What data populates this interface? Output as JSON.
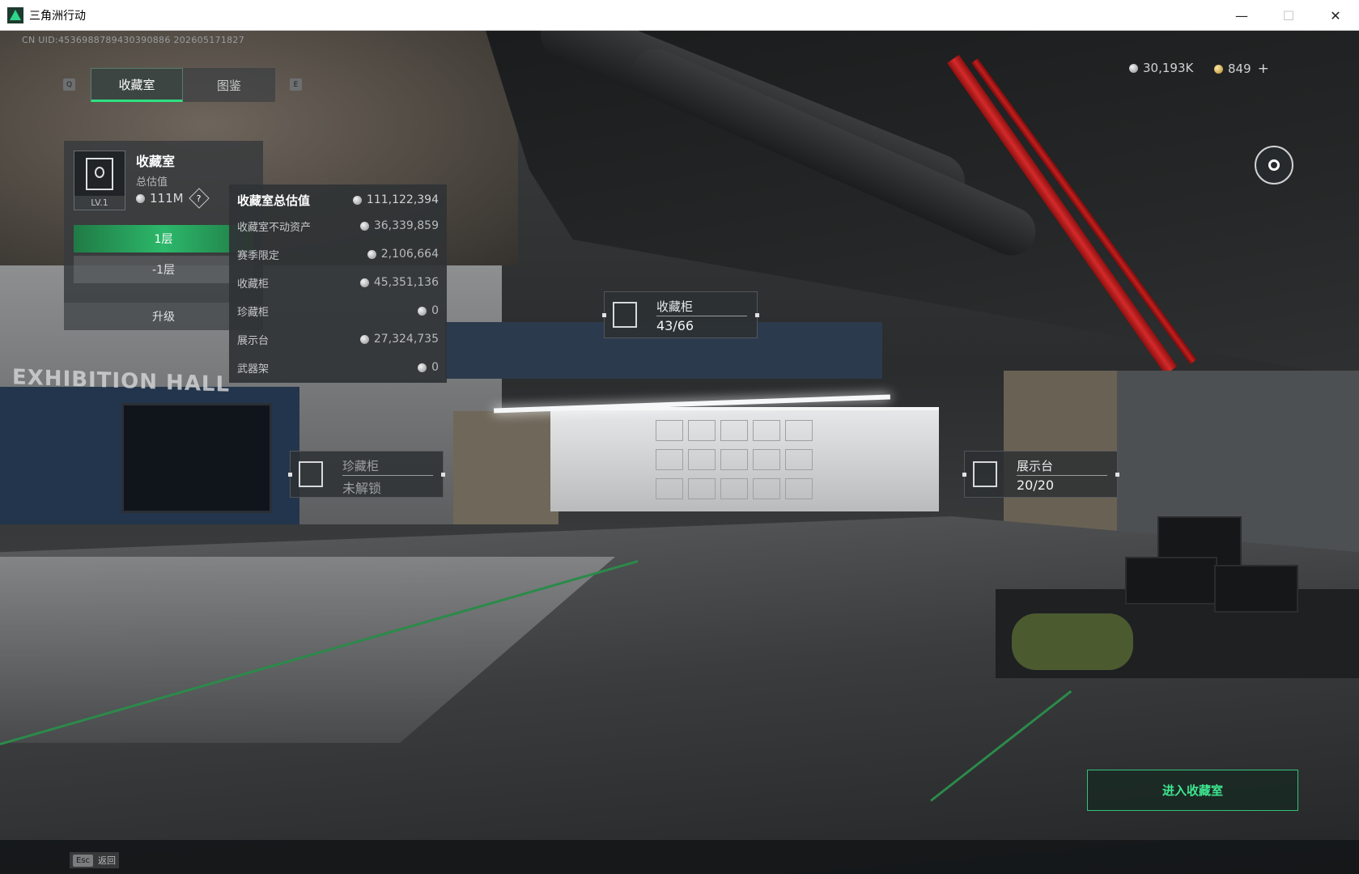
{
  "window": {
    "title": "三角洲行动",
    "minimize": "—",
    "maximize": "☐",
    "close": "✕"
  },
  "uid": "CN UID:4536988789430390886 202605171827",
  "currency": {
    "silver": "30,193K",
    "gold": "849",
    "plus": "+"
  },
  "tabs": {
    "key_left": "Q",
    "key_right": "E",
    "items": [
      {
        "label": "收藏室",
        "active": true
      },
      {
        "label": "图鉴",
        "active": false
      }
    ]
  },
  "room": {
    "title": "收藏室",
    "subtitle": "总估值",
    "value": "111M",
    "level": "LV.1",
    "help": "?",
    "floors": [
      "1层",
      "-1层"
    ],
    "upgrade": "升级"
  },
  "valuation": {
    "rows": [
      {
        "label": "收藏室总估值",
        "value": "111,122,394"
      },
      {
        "label": "收藏室不动资产",
        "value": "36,339,859"
      },
      {
        "label": "赛季限定",
        "value": "2,106,664"
      },
      {
        "label": "收藏柜",
        "value": "45,351,136"
      },
      {
        "label": "珍藏柜",
        "value": "0"
      },
      {
        "label": "展示台",
        "value": "27,324,735"
      },
      {
        "label": "武器架",
        "value": "0"
      }
    ]
  },
  "hotspots": {
    "cabinet": {
      "title": "收藏柜",
      "value": "43/66"
    },
    "treasure": {
      "title": "珍藏柜",
      "value": "未解锁"
    },
    "display": {
      "title": "展示台",
      "value": "20/20"
    }
  },
  "scene_text": {
    "hall": "EXHIBITION HALL"
  },
  "enter_button": "进入收藏室",
  "footer": {
    "esc_key": "Esc",
    "esc_label": "返回"
  },
  "colors": {
    "accent_green": "#2ee07f",
    "enter_green": "#3ee68f",
    "pipe_red": "#d42a2a"
  }
}
